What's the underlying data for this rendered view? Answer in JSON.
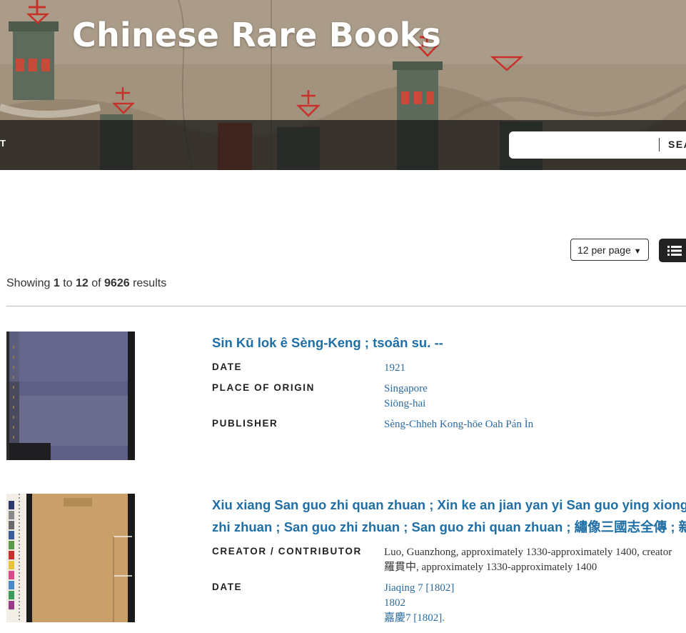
{
  "header": {
    "title": "Chinese Rare Books",
    "nav_fragment": "T",
    "search": {
      "placeholder": "",
      "button_label": "SEA"
    }
  },
  "toolbar": {
    "per_page_label": "12 per page",
    "view_icon": "list-view-icon"
  },
  "results_summary": {
    "prefix": "Showing",
    "start": "1",
    "to_word": "to",
    "end": "12",
    "of_word": "of",
    "total": "9626",
    "suffix": "results"
  },
  "results": [
    {
      "title": "Sin Kū lok ê Sèng-Keng ; tsoân su. --",
      "fields": [
        {
          "label": "DATE",
          "values": [
            "1921"
          ]
        },
        {
          "label": "PLACE OF ORIGIN",
          "values": [
            "Singapore",
            "Siōng-hai"
          ]
        },
        {
          "label": "PUBLISHER",
          "values": [
            "Sèng-Chheh Kong-hōe Oah Pán Ìn"
          ]
        }
      ]
    },
    {
      "title_lines": [
        "Xiu xiang San guo zhi quan zhuan ; Xin ke an jian yan yi San guo ying xiong",
        "zhi zhuan ; San guo zhi zhuan ; San guo zhi quan zhuan ; 繡像三國志全傳 ; 新"
      ],
      "fields": [
        {
          "label": "CREATOR / CONTRIBUTOR",
          "values": [
            "Luo, Guanzhong, approximately 1330-approximately 1400, creator",
            "羅貫中, approximately 1330-approximately 1400"
          ]
        },
        {
          "label": "DATE",
          "values": [
            "Jiaqing 7 [1802]",
            "1802",
            "嘉慶7 [1802]."
          ]
        }
      ]
    }
  ],
  "colors": {
    "link": "#2a6aa0",
    "title": "#1f6fa6",
    "nav_bg": "#222222"
  }
}
